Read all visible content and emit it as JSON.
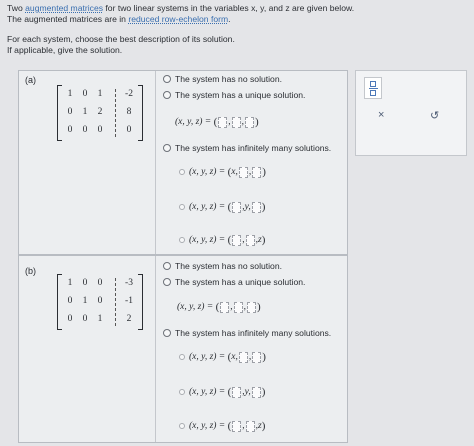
{
  "intro": {
    "line1_pre": "Two ",
    "line1_link": "augmented matrices",
    "line1_post": " for two linear systems in the variables x, y, and z are given below.",
    "line2_pre": "The augmented matrices are in ",
    "line2_link": "reduced row-echelon form",
    "line2_post": ".",
    "line3": "For each system, choose the best description of its solution.",
    "line4": "If applicable, give the solution."
  },
  "parts": [
    {
      "label": "(a)",
      "matrix": [
        [
          "1",
          "0",
          "1",
          "-2"
        ],
        [
          "0",
          "1",
          "2",
          "8"
        ],
        [
          "0",
          "0",
          "0",
          "0"
        ]
      ],
      "options": {
        "no_solution": "The system has no solution.",
        "unique": "The system has a unique solution.",
        "infinite": "The system has infinitely many solutions."
      },
      "unique_form": {
        "lhs": "(x, y, z) ="
      },
      "infinite_forms": [
        {
          "lhs": "(x, y, z) =",
          "pre": "x,",
          "mid": "",
          "post": ""
        },
        {
          "lhs": "(x, y, z) =",
          "pre": "",
          "mid": "y,",
          "post": ""
        },
        {
          "lhs": "(x, y, z) =",
          "pre": "",
          "mid": "",
          "post": "z"
        }
      ]
    },
    {
      "label": "(b)",
      "matrix": [
        [
          "1",
          "0",
          "0",
          "-3"
        ],
        [
          "0",
          "1",
          "0",
          "-1"
        ],
        [
          "0",
          "0",
          "1",
          "2"
        ]
      ],
      "options": {
        "no_solution": "The system has no solution.",
        "unique": "The system has a unique solution.",
        "infinite": "The system has infinitely many solutions."
      },
      "unique_form": {
        "lhs": "(x, y, z) ="
      },
      "infinite_forms": [
        {
          "lhs": "(x, y, z) =",
          "pre": "x,",
          "mid": "",
          "post": ""
        },
        {
          "lhs": "(x, y, z) =",
          "pre": "",
          "mid": "y,",
          "post": ""
        },
        {
          "lhs": "(x, y, z) =",
          "pre": "",
          "mid": "",
          "post": "z"
        }
      ]
    }
  ],
  "tools": {
    "fraction_icon": "fraction-template-icon",
    "clear_label": "×",
    "undo_label": "↺"
  },
  "colors": {
    "link": "#3a6fb0",
    "accent": "#4c78b8"
  }
}
